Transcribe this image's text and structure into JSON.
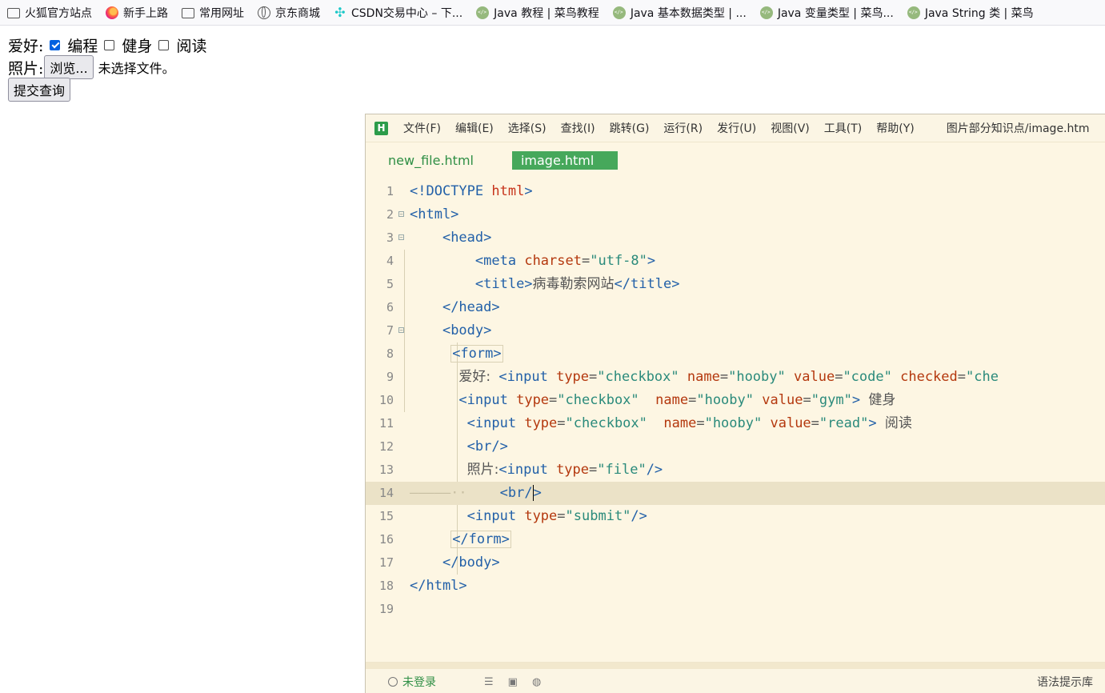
{
  "bookmarks": [
    {
      "icon": "folder-icon",
      "label": "火狐官方站点"
    },
    {
      "icon": "firefox-icon",
      "label": "新手上路"
    },
    {
      "icon": "folder-icon",
      "label": "常用网址"
    },
    {
      "icon": "globe-icon",
      "label": "京东商城"
    },
    {
      "icon": "csdn-icon",
      "label": "CSDN交易中心 – 下..."
    },
    {
      "icon": "runoob-icon",
      "label": "Java 教程 | 菜鸟教程"
    },
    {
      "icon": "runoob-icon",
      "label": "Java 基本数据类型 | ..."
    },
    {
      "icon": "runoob-icon",
      "label": "Java 变量类型 | 菜鸟..."
    },
    {
      "icon": "runoob-icon",
      "label": "Java String 类 | 菜鸟"
    }
  ],
  "form": {
    "hobby_label": "爱好:",
    "hobbies": [
      {
        "label": "编程",
        "checked": true
      },
      {
        "label": "健身",
        "checked": false
      },
      {
        "label": "阅读",
        "checked": false
      }
    ],
    "photo_label": "照片:",
    "browse_button": "浏览...",
    "no_file_text": "未选择文件。",
    "submit_button": "提交查询"
  },
  "editor": {
    "logo": "H",
    "menus": [
      "文件(F)",
      "编辑(E)",
      "选择(S)",
      "查找(I)",
      "跳转(G)",
      "运行(R)",
      "发行(U)",
      "视图(V)",
      "工具(T)",
      "帮助(Y)"
    ],
    "window_title": "图片部分知识点/image.htm",
    "tabs": [
      {
        "label": "new_file.html",
        "active": false
      },
      {
        "label": "image.html",
        "active": true
      }
    ],
    "line_numbers": [
      "1",
      "2",
      "3",
      "4",
      "5",
      "6",
      "7",
      "8",
      "9",
      "10",
      "11",
      "12",
      "13",
      "14",
      "15",
      "16",
      "17",
      "18",
      "19"
    ],
    "status": {
      "login": "未登录",
      "hint": "语法提示库"
    },
    "accent_color": "#46a85b"
  }
}
